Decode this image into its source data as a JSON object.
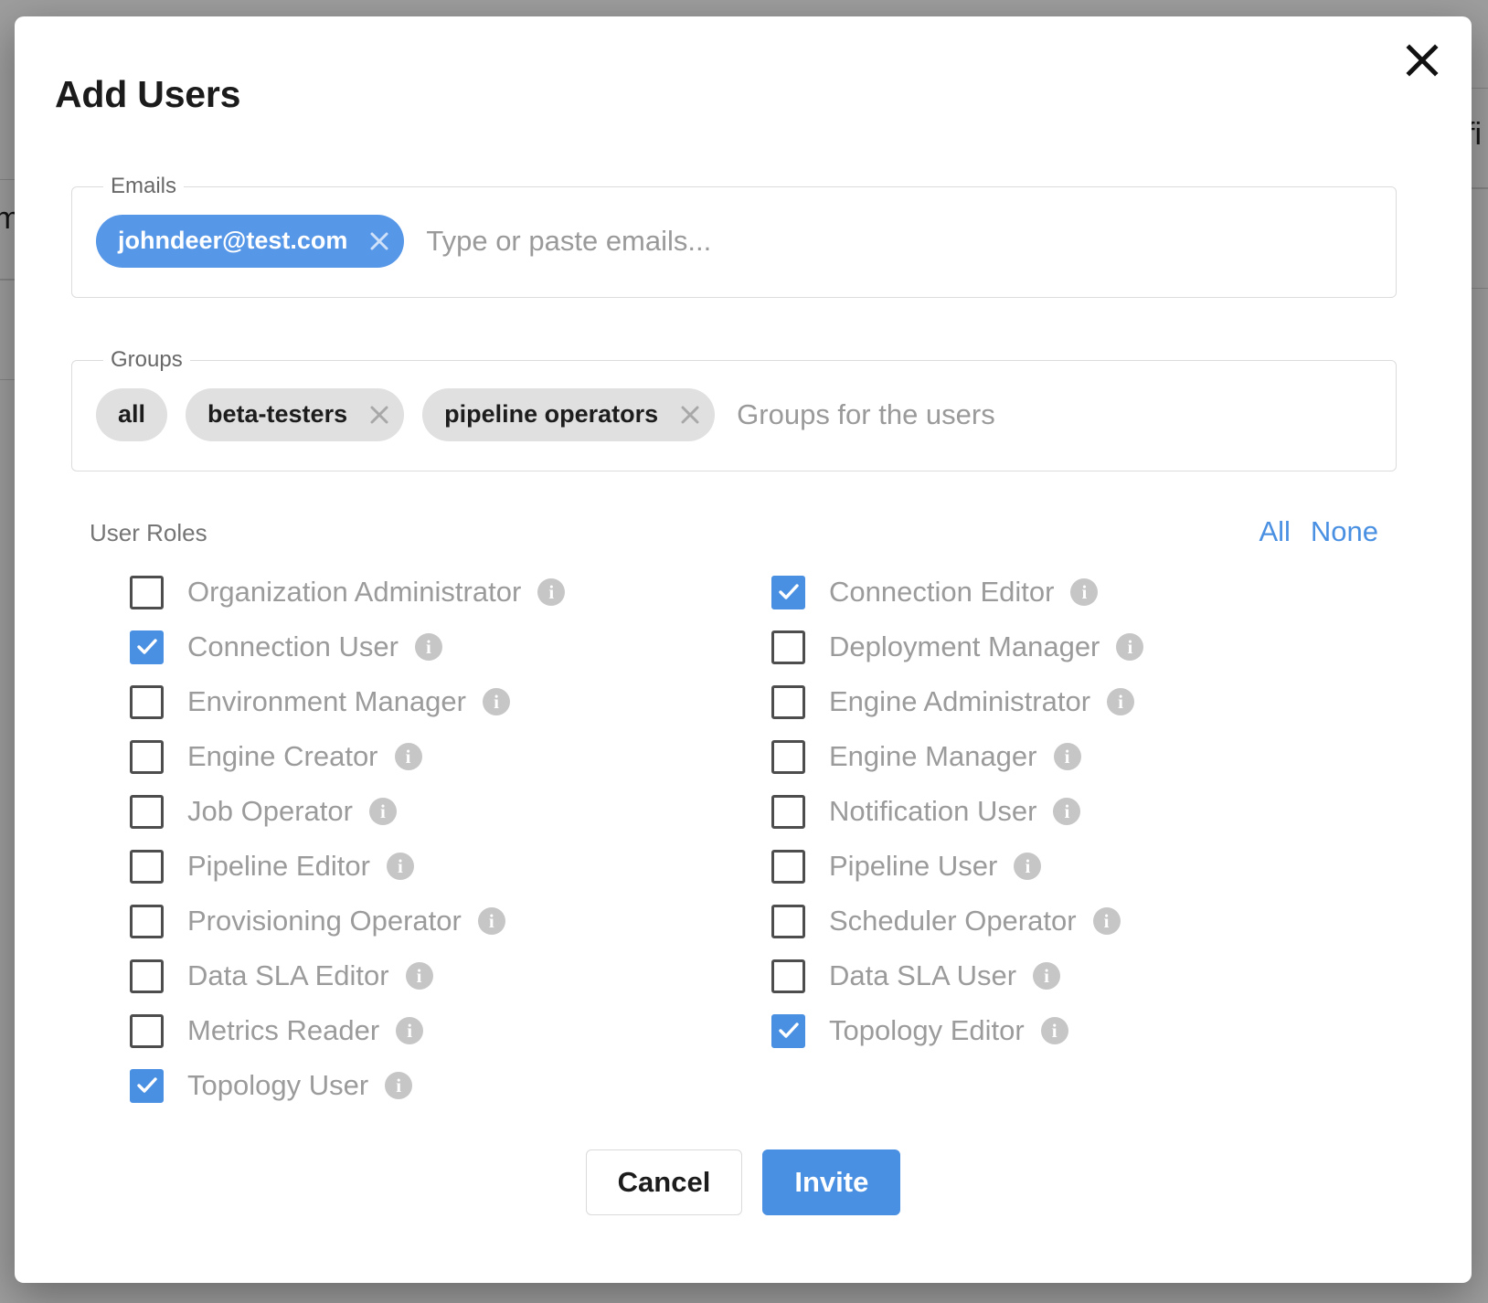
{
  "background": {
    "left_text": "m",
    "right_text": "fi"
  },
  "dialog": {
    "title": "Add Users",
    "close_icon": "close-icon"
  },
  "emails": {
    "legend": "Emails",
    "placeholder": "Type or paste emails...",
    "chips": [
      {
        "label": "johndeer@test.com",
        "removable": true,
        "style": "blue"
      }
    ]
  },
  "groups": {
    "legend": "Groups",
    "placeholder": "Groups for the users",
    "chips": [
      {
        "label": "all",
        "removable": false,
        "style": "grey"
      },
      {
        "label": "beta-testers",
        "removable": true,
        "style": "grey"
      },
      {
        "label": "pipeline operators",
        "removable": true,
        "style": "grey"
      }
    ]
  },
  "roles": {
    "label": "User Roles",
    "select_all_label": "All",
    "select_none_label": "None",
    "left_column": [
      {
        "label": "Organization Administrator",
        "checked": false
      },
      {
        "label": "Connection User",
        "checked": true
      },
      {
        "label": "Environment Manager",
        "checked": false
      },
      {
        "label": "Engine Creator",
        "checked": false
      },
      {
        "label": "Job Operator",
        "checked": false
      },
      {
        "label": "Pipeline Editor",
        "checked": false
      },
      {
        "label": "Provisioning Operator",
        "checked": false
      },
      {
        "label": "Data SLA Editor",
        "checked": false
      },
      {
        "label": "Metrics Reader",
        "checked": false
      },
      {
        "label": "Topology User",
        "checked": true
      }
    ],
    "right_column": [
      {
        "label": "Connection Editor",
        "checked": true
      },
      {
        "label": "Deployment Manager",
        "checked": false
      },
      {
        "label": "Engine Administrator",
        "checked": false
      },
      {
        "label": "Engine Manager",
        "checked": false
      },
      {
        "label": "Notification User",
        "checked": false
      },
      {
        "label": "Pipeline User",
        "checked": false
      },
      {
        "label": "Scheduler Operator",
        "checked": false
      },
      {
        "label": "Data SLA User",
        "checked": false
      },
      {
        "label": "Topology Editor",
        "checked": true
      }
    ],
    "info_icon": "info-icon"
  },
  "footer": {
    "cancel_label": "Cancel",
    "invite_label": "Invite"
  },
  "colors": {
    "accent": "#4a90e2",
    "chip_blue": "#5697e8",
    "chip_grey": "#e0e0e0",
    "label_grey": "#9b9b9b",
    "info_grey": "#c6c6c6"
  }
}
